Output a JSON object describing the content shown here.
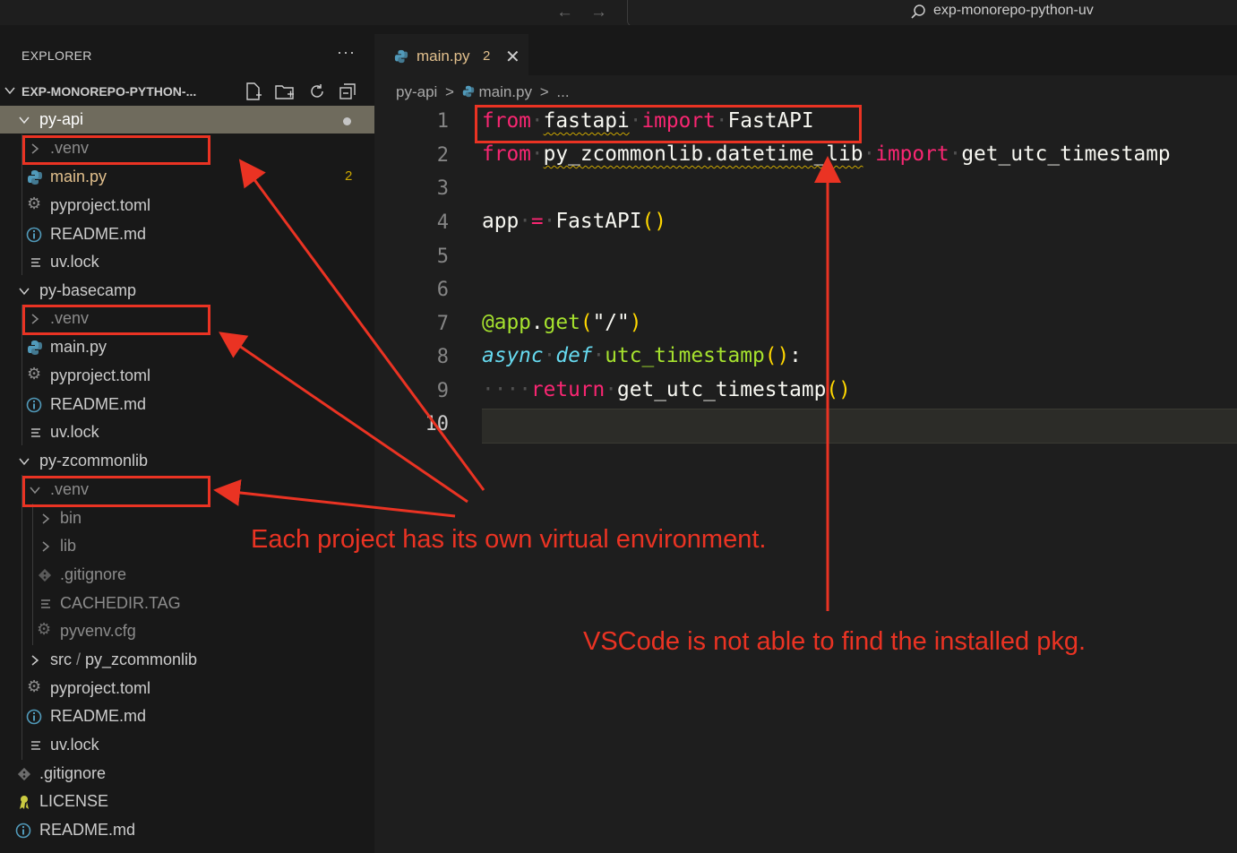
{
  "titlebar": {
    "search_text": "exp-monorepo-python-uv",
    "back_icon": "arrow-left-icon",
    "forward_icon": "arrow-right-icon"
  },
  "sidebar": {
    "title": "EXPLORER",
    "more": "···",
    "workspace": "EXP-MONOREPO-PYTHON-...",
    "workspace_actions": [
      "new-file-icon",
      "new-folder-icon",
      "refresh-icon",
      "collapse-all-icon"
    ],
    "tree": {
      "r0": "py-api",
      "r1": ".venv",
      "r2": "main.py",
      "r2_badge": "2",
      "r3": "pyproject.toml",
      "r4": "README.md",
      "r5": "uv.lock",
      "r6": "py-basecamp",
      "r7": ".venv",
      "r8": "main.py",
      "r9": "pyproject.toml",
      "r10": "README.md",
      "r11": "uv.lock",
      "r12": "py-zcommonlib",
      "r13": ".venv",
      "r14": "bin",
      "r15": "lib",
      "r16": ".gitignore",
      "r17": "CACHEDIR.TAG",
      "r18": "pyvenv.cfg",
      "r19a": "src",
      "r19b": "py_zcommonlib",
      "r20": "pyproject.toml",
      "r21": "README.md",
      "r22": "uv.lock",
      "r23": ".gitignore",
      "r24": "LICENSE",
      "r25": "README.md"
    }
  },
  "editor": {
    "tab": {
      "label": "main.py",
      "badge": "2",
      "close": "✕"
    },
    "breadcrumb": {
      "folder": "py-api",
      "sep": ">",
      "file": "main.py",
      "more": "..."
    },
    "line_numbers": [
      "1",
      "2",
      "3",
      "4",
      "5",
      "6",
      "7",
      "8",
      "9",
      "10"
    ],
    "code": {
      "l1_from": "from",
      "l1_mod": "fastapi",
      "l1_import": "import",
      "l1_name": "FastAPI",
      "l2_from": "from",
      "l2_mod": "py_zcommonlib.datetime_lib",
      "l2_import": "import",
      "l2_name": "get_utc_timestamp",
      "l4_app": "app",
      "l4_eq": "=",
      "l4_call": "FastAPI",
      "l4_paren": "()",
      "l7_at": "@app",
      "l7_dot": ".",
      "l7_get": "get",
      "l7_open": "(",
      "l7_str": "\"/\"",
      "l7_close": ")",
      "l8_async": "async",
      "l8_def": "def",
      "l8_fn": "utc_timestamp",
      "l8_paren": "()",
      "l8_colon": ":",
      "l9_ws": "···",
      "l9_return": "return",
      "l9_call": "get_utc_timestamp",
      "l9_paren": "()"
    }
  },
  "annotations": {
    "left_note": "Each project has its own virtual environment.",
    "right_note": "VSCode is not able to find the installed pkg.",
    "color": "#ea3323"
  }
}
